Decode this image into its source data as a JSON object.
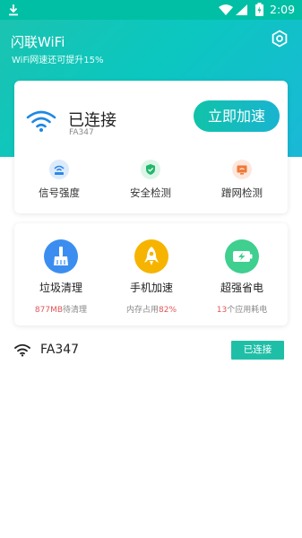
{
  "status_bar": {
    "time": "2:09"
  },
  "header": {
    "title": "闪联WiFi",
    "subtitle": "WiFi网速还可提升15%"
  },
  "connection": {
    "status": "已连接",
    "ssid": "FA347",
    "speed_button": "立即加速"
  },
  "tools": [
    {
      "label": "信号强度",
      "icon": "signal-strength-icon"
    },
    {
      "label": "安全检测",
      "icon": "security-shield-icon"
    },
    {
      "label": "蹭网检测",
      "icon": "router-detect-icon"
    }
  ],
  "features": [
    {
      "name": "垃圾清理",
      "highlight": "877MB",
      "suffix": "待清理",
      "prefix": "",
      "icon": "broom-icon"
    },
    {
      "name": "手机加速",
      "prefix": "内存占用",
      "highlight": "82%",
      "suffix": "",
      "icon": "rocket-icon"
    },
    {
      "name": "超强省电",
      "prefix": "",
      "highlight": "13",
      "suffix": "个应用耗电",
      "icon": "battery-charge-icon"
    }
  ],
  "network_list": [
    {
      "ssid": "FA347",
      "status": "已连接"
    }
  ],
  "colors": {
    "accent": "#1bc3b1",
    "warn": "#e05757",
    "clean_blue": "#3b8ef0",
    "rocket_yellow": "#f6b400",
    "battery_green": "#3fcf8f"
  }
}
